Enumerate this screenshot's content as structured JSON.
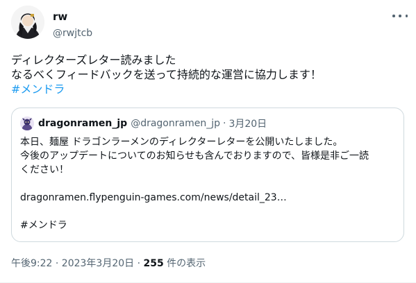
{
  "tweet": {
    "author": {
      "display_name": "rw",
      "handle": "@rwjtcb"
    },
    "text_lines": [
      "ディレクターズレター読みました",
      "なるべくフィードバックを送って持続的な運営に協力します！"
    ],
    "hashtag": "#メンドラ",
    "timestamp": "午後9:22 · 2023年3月20日",
    "separator": " · ",
    "views_count": "255",
    "views_label": " 件の表示"
  },
  "quoted_tweet": {
    "author": {
      "display_name": "dragonramen_jp",
      "handle": "@dragonramen_jp",
      "separator": "·",
      "date": "3月20日"
    },
    "body_lines": [
      "本日、麺屋 ドラゴンラーメンのディレクターレターを公開いたしました。",
      "今後のアップデートについてのお知らせも含んでおりますので、皆様是非ご一読",
      "ください！",
      "",
      "dragonramen.flypenguin-games.com/news/detail_23…",
      "",
      "#メンドラ"
    ]
  },
  "icons": {
    "more": "more-options-icon"
  },
  "colors": {
    "text": "#0f1419",
    "secondary": "#536471",
    "link": "#1d9bf0",
    "border": "#cfd9de"
  }
}
